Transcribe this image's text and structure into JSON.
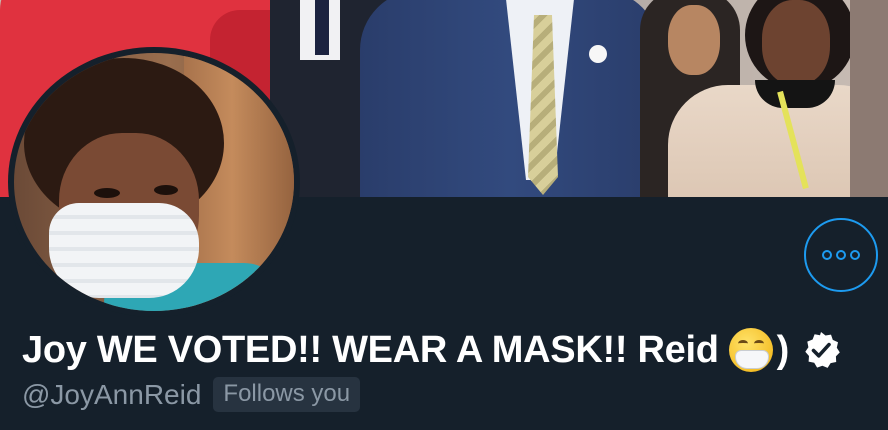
{
  "profile": {
    "display_name": "Joy WE VOTED!! WEAR A MASK!! Reid",
    "name_suffix": ")",
    "handle": "@JoyAnnReid",
    "follows_badge": "Follows you",
    "emoji": "face-with-medical-mask-icon",
    "verified": true
  },
  "colors": {
    "background": "#15202b",
    "accent": "#1d9bf0",
    "secondary_text": "#8b98a5",
    "badge_bg": "#273340"
  },
  "icons": {
    "more": "more-dots-icon",
    "verified": "verified-badge-icon"
  }
}
